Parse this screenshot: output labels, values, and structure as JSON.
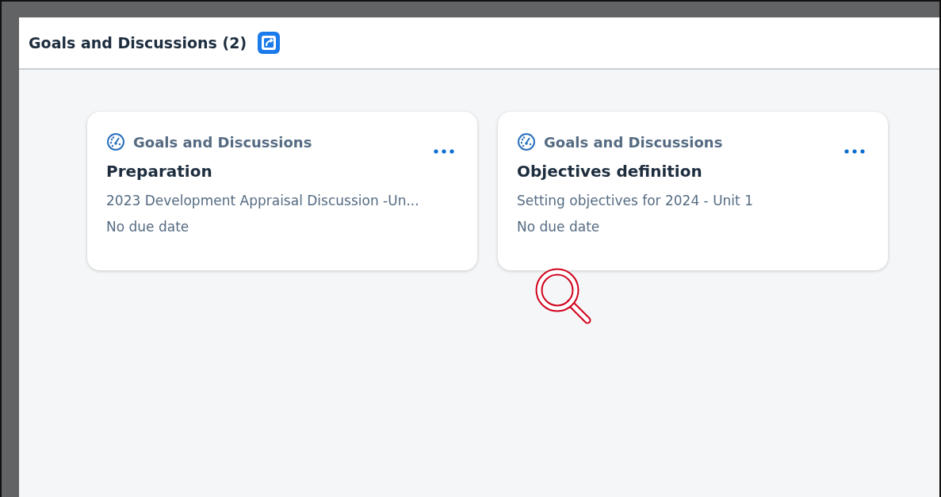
{
  "header": {
    "title": "Goals and Discussions (2)"
  },
  "cards": [
    {
      "category": "Goals and Discussions",
      "title": "Preparation",
      "description": "2023 Development Appraisal Discussion -Un...",
      "due": "No due date"
    },
    {
      "category": "Goals and Discussions",
      "title": "Objectives definition",
      "description": "Setting objectives for 2024 - Unit 1",
      "due": "No due date"
    }
  ]
}
